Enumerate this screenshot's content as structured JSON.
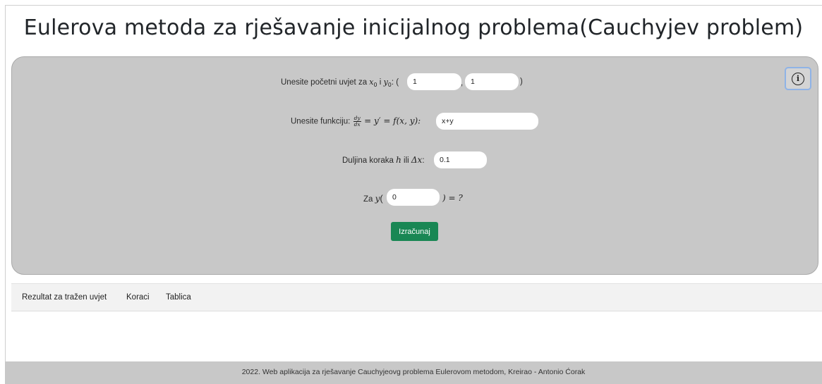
{
  "title": "Eulerova metoda za rješavanje inicijalnog problema(Cauchyjev problem)",
  "info_button": {
    "icon": "info-icon",
    "glyph": "i"
  },
  "condition": {
    "label_prefix": "Unesite početni uvjet za ",
    "x0": "x",
    "x0_sub": "0",
    "and": " i ",
    "y0": "y",
    "y0_sub": "0",
    "colon_open": ": (",
    "x0_value": "1",
    "comma": ",",
    "y0_value": "1",
    "close": ")"
  },
  "function": {
    "label_prefix": "Unesite funkciju: ",
    "frac_num": "dy",
    "frac_den": "dx",
    "equation": "= y′ = f(x, y):",
    "value": "x+y"
  },
  "step": {
    "label_prefix": "Duljina koraka ",
    "h": "h",
    "or": " ili ",
    "dx": "Δx",
    "colon": ":",
    "value": "0.1"
  },
  "target": {
    "label_prefix": "Za ",
    "y": "y",
    "open": "(",
    "value": "0",
    "close": ") = ?"
  },
  "calculate_button": {
    "label": "Izračunaj",
    "color": "#198754"
  },
  "tabs": [
    "Rezultat za tražen uvjet",
    "Koraci",
    "Tablica"
  ],
  "footer": "2022. Web aplikacija za rješavanje Cauchyjeovg problema Eulerovom metodom, Kreirao - Antonio Ćorak",
  "colors": {
    "panel": "#c8c8c8",
    "footer": "#c8c8c8",
    "tabs_bg": "#f2f2f2"
  }
}
